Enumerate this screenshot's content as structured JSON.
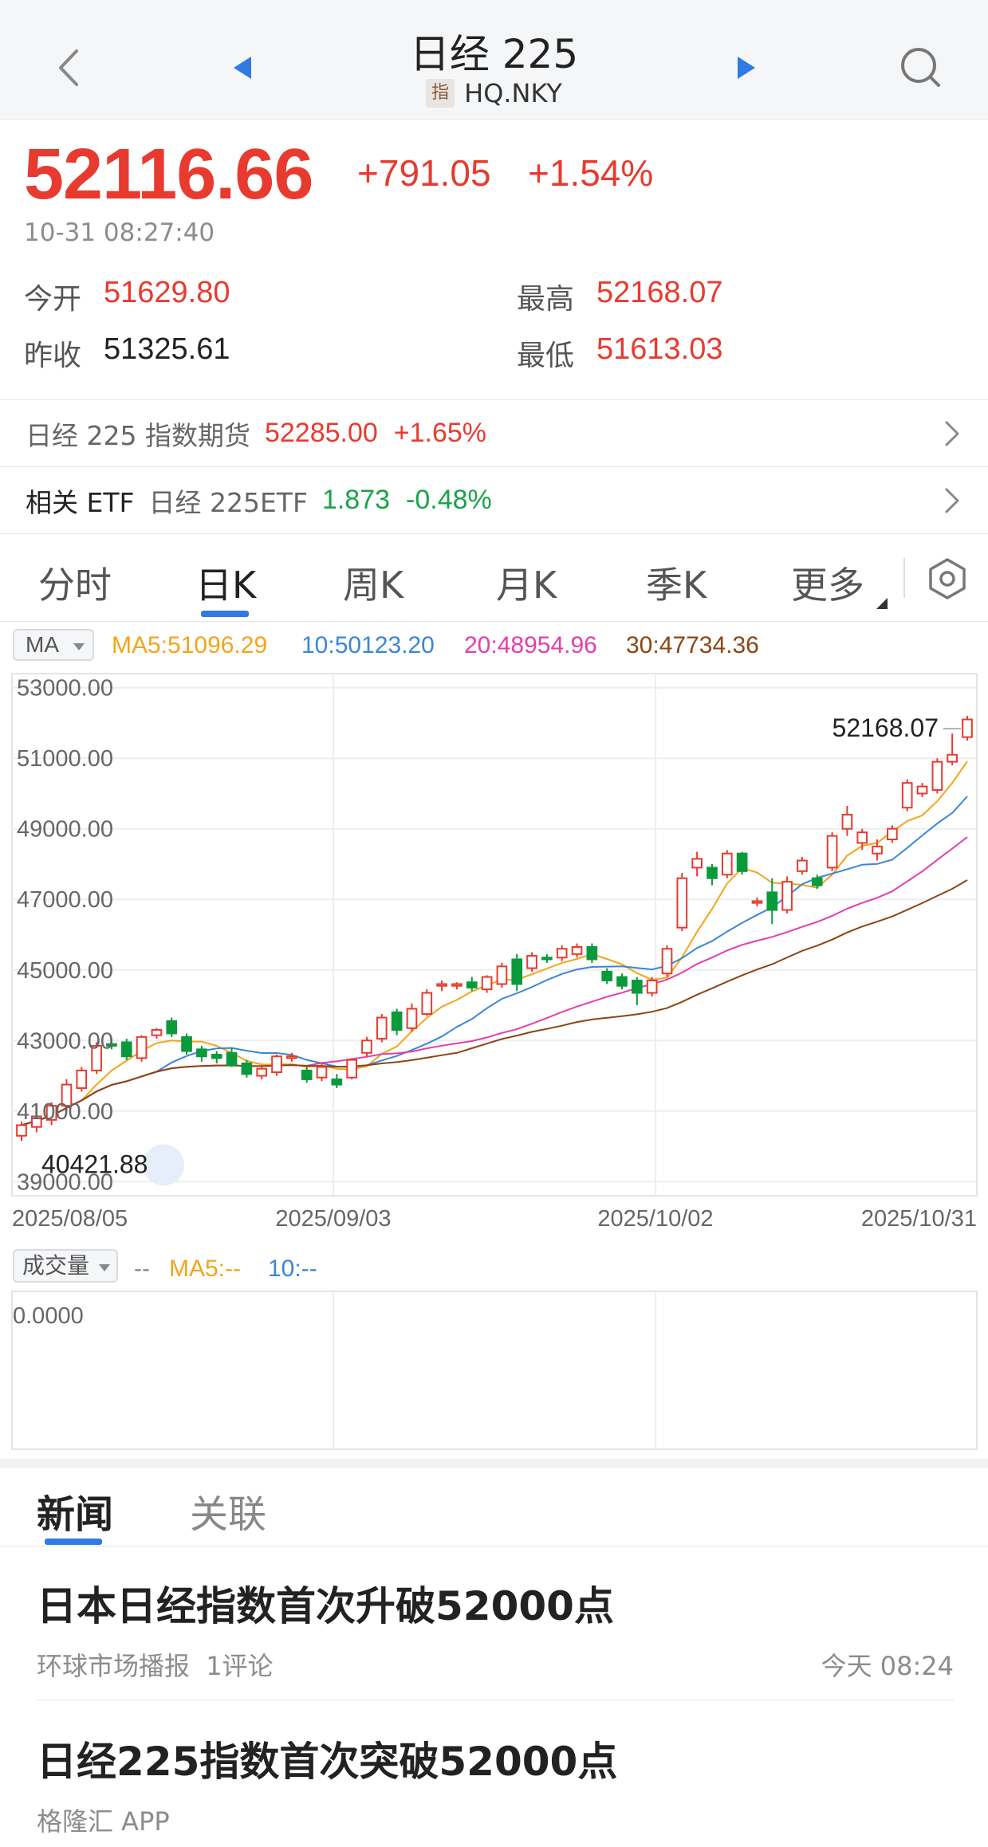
{
  "header": {
    "title": "日经 225",
    "badge": "指",
    "code": "HQ.NKY"
  },
  "quote": {
    "price": "52116.66",
    "change": "+791.05",
    "change_pct": "+1.54%",
    "timestamp": "10-31 08:27:40",
    "open_label": "今开",
    "open": "51629.80",
    "high_label": "最高",
    "high": "52168.07",
    "prev_close_label": "昨收",
    "prev_close": "51325.61",
    "low_label": "最低",
    "low": "51613.03"
  },
  "futures": {
    "label": "日经 225 指数期货",
    "price": "52285.00",
    "pct": "+1.65%"
  },
  "etf": {
    "label": "相关 ETF",
    "name": "日经 225ETF",
    "price": "1.873",
    "pct": "-0.48%"
  },
  "tabs": [
    {
      "label": "分时"
    },
    {
      "label": "日K"
    },
    {
      "label": "周K"
    },
    {
      "label": "月K"
    },
    {
      "label": "季K"
    },
    {
      "label": "更多"
    }
  ],
  "ma": {
    "select": "MA",
    "ma5": "MA5:51096.29",
    "ma10": "10:50123.20",
    "ma20": "20:48954.96",
    "ma30": "30:47734.36"
  },
  "colors": {
    "up": "#e93a2f",
    "down": "#0a9a3c",
    "ma5": "#f2a51a",
    "ma10": "#3b86d6",
    "ma20": "#e53ea8",
    "ma30": "#8b4513",
    "accent": "#2f7ae5"
  },
  "chart_data": {
    "type": "candlestick",
    "y_ticks": [
      "53000.00",
      "51000.00",
      "49000.00",
      "47000.00",
      "45000.00",
      "43000.00",
      "41000.00",
      "39000.00"
    ],
    "y_tick_values": [
      53000,
      51000,
      49000,
      47000,
      45000,
      43000,
      41000,
      39000
    ],
    "ylim": [
      38600,
      53400
    ],
    "x_labels": [
      "2025/08/05",
      "2025/09/03",
      "2025/10/02",
      "2025/10/31"
    ],
    "max_label": "52168.07",
    "min_label": "40421.88",
    "candles": [
      [
        40300,
        40600,
        40150,
        40700
      ],
      [
        40550,
        40850,
        40400,
        40950
      ],
      [
        40750,
        41150,
        40600,
        41250
      ],
      [
        41150,
        41750,
        41050,
        41900
      ],
      [
        41650,
        42150,
        41550,
        42250
      ],
      [
        42150,
        42850,
        42050,
        42950
      ],
      [
        42900,
        42850,
        42750,
        43050
      ],
      [
        42950,
        42550,
        42450,
        43050
      ],
      [
        42500,
        43100,
        42400,
        43150
      ],
      [
        43150,
        43300,
        43050,
        43350
      ],
      [
        43550,
        43200,
        43100,
        43650
      ],
      [
        43100,
        42700,
        42600,
        43200
      ],
      [
        42750,
        42550,
        42400,
        42850
      ],
      [
        42600,
        42500,
        42350,
        42700
      ],
      [
        42650,
        42300,
        42250,
        42800
      ],
      [
        42350,
        42050,
        41950,
        42450
      ],
      [
        42000,
        42200,
        41900,
        42300
      ],
      [
        42100,
        42550,
        42000,
        42600
      ],
      [
        42500,
        42550,
        42400,
        42650
      ],
      [
        42150,
        41900,
        41800,
        42250
      ],
      [
        41950,
        42250,
        41850,
        42350
      ],
      [
        41900,
        41750,
        41650,
        42050
      ],
      [
        41950,
        42450,
        41900,
        42500
      ],
      [
        42650,
        43000,
        42550,
        43100
      ],
      [
        43050,
        43650,
        42950,
        43750
      ],
      [
        43800,
        43300,
        43150,
        43900
      ],
      [
        43350,
        43900,
        43250,
        44050
      ],
      [
        43750,
        44350,
        43700,
        44450
      ],
      [
        44550,
        44600,
        44400,
        44700
      ],
      [
        44550,
        44600,
        44450,
        44650
      ],
      [
        44650,
        44500,
        44400,
        44800
      ],
      [
        44450,
        44800,
        44350,
        44850
      ],
      [
        44600,
        45100,
        44500,
        45200
      ],
      [
        45300,
        44600,
        44400,
        45450
      ],
      [
        45050,
        45400,
        44950,
        45500
      ],
      [
        45350,
        45300,
        45200,
        45450
      ],
      [
        45350,
        45600,
        45250,
        45700
      ],
      [
        45450,
        45650,
        45350,
        45750
      ],
      [
        45650,
        45300,
        45200,
        45750
      ],
      [
        44950,
        44700,
        44600,
        45050
      ],
      [
        44800,
        44550,
        44450,
        44900
      ],
      [
        44700,
        44350,
        44000,
        44800
      ],
      [
        44350,
        44700,
        44250,
        44800
      ],
      [
        44900,
        45600,
        44800,
        45700
      ],
      [
        46200,
        47600,
        46100,
        47750
      ],
      [
        47900,
        48150,
        47650,
        48350
      ],
      [
        47900,
        47600,
        47400,
        48000
      ],
      [
        47700,
        48300,
        47600,
        48400
      ],
      [
        48300,
        47800,
        47700,
        48350
      ],
      [
        46900,
        46950,
        46800,
        47050
      ],
      [
        47200,
        46700,
        46300,
        47600
      ],
      [
        46700,
        47500,
        46600,
        47650
      ],
      [
        47800,
        48100,
        47700,
        48200
      ],
      [
        47600,
        47400,
        47300,
        47700
      ],
      [
        47900,
        48800,
        47800,
        48900
      ],
      [
        49000,
        49400,
        48800,
        49650
      ],
      [
        48600,
        48900,
        48400,
        49000
      ],
      [
        48300,
        48500,
        48100,
        48700
      ],
      [
        48700,
        49000,
        48600,
        49100
      ],
      [
        49600,
        50300,
        49500,
        50400
      ],
      [
        50000,
        50200,
        49900,
        50300
      ],
      [
        50100,
        50900,
        50000,
        51000
      ],
      [
        50900,
        51100,
        50800,
        51700
      ],
      [
        51600,
        52100,
        51500,
        52200
      ]
    ]
  },
  "volume": {
    "select": "成交量",
    "value": "--",
    "ma5": "MA5:--",
    "ma10": "10:--",
    "axis_label": "0.0000"
  },
  "news_tabs": [
    {
      "label": "新闻"
    },
    {
      "label": "关联"
    }
  ],
  "news": [
    {
      "title": "日本日经指数首次升破52000点",
      "source": "环球市场播报",
      "comments": "1评论",
      "time": "今天 08:24"
    },
    {
      "title": "日经225指数首次突破52000点",
      "source": "格隆汇 APP",
      "comments": "",
      "time": ""
    }
  ]
}
